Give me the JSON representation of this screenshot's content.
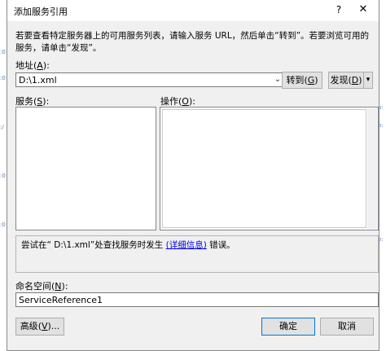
{
  "dialog": {
    "title": "添加服务引用",
    "help_glyph": "?",
    "close_glyph": "✕"
  },
  "description": "若要查看特定服务器上的可用服务列表，请输入服务 URL，然后单击“转到”。若要浏览可用的服务，请单击“发现”。",
  "address": {
    "label": "地址",
    "accel": "A",
    "value": "D:\\1.xml",
    "dropdown_glyph": "⌄"
  },
  "buttons": {
    "go_label": "转到",
    "go_accel": "G",
    "discover_label": "发现",
    "discover_accel": "D",
    "discover_arrow": "▾",
    "advanced_label": "高级",
    "advanced_accel": "V",
    "ok_label": "确定",
    "cancel_label": "取消"
  },
  "services": {
    "label": "服务",
    "accel": "S"
  },
  "operations": {
    "label": "操作",
    "accel": "O"
  },
  "error": {
    "prefix": "尝试在“ D:\\1.xml”处查找服务时发生",
    "link": "(详细信息)",
    "suffix": " 错误。"
  },
  "namespace": {
    "label": "命名空间",
    "accel": "N",
    "value": "ServiceReference1"
  }
}
